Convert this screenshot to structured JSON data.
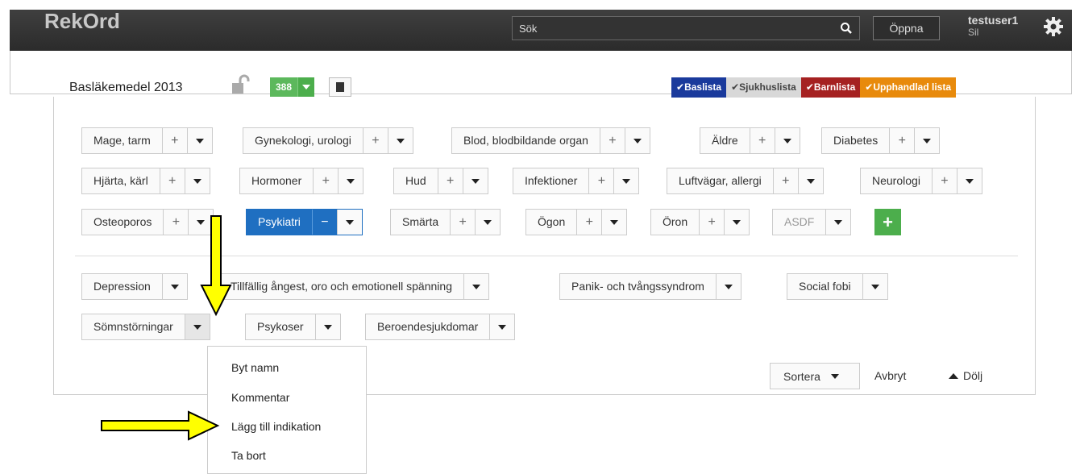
{
  "app": {
    "title": "RekOrd"
  },
  "search": {
    "placeholder": "Sök",
    "open_label": "Öppna"
  },
  "user": {
    "name": "testuser1",
    "org": "Sil"
  },
  "list": {
    "name": "Basläkemedel 2013",
    "count": "388"
  },
  "list_tabs": [
    {
      "label": "Baslista",
      "color": "#1a3a9c"
    },
    {
      "label": "Sjukhuslista",
      "color": "#d8d8d8"
    },
    {
      "label": "Barnlista",
      "color": "#a52121"
    },
    {
      "label": "Upphandlad lista",
      "color": "#e88a0c"
    }
  ],
  "groups": [
    "Mage, tarm",
    "Gynekologi, urologi",
    "Blod, blodbildande organ",
    "Äldre",
    "Diabetes",
    "Hjärta, kärl",
    "Hormoner",
    "Hud",
    "Infektioner",
    "Luftvägar, allergi",
    "Neurologi",
    "Osteoporos",
    "Psykiatri",
    "Smärta",
    "Ögon",
    "Öron",
    "ASDF"
  ],
  "subgroups": [
    "Depression",
    "Tillfällig ångest, oro och emotionell spänning",
    "Panik- och tvångssyndrom",
    "Social fobi",
    "Sömnstörningar",
    "Psykoser",
    "Beroendesjukdomar"
  ],
  "menu": [
    "Byt namn",
    "Kommentar",
    "Lägg till indikation",
    "Ta bort"
  ],
  "actions": {
    "sort": "Sortera",
    "cancel": "Avbryt",
    "hide": "Dölj"
  }
}
